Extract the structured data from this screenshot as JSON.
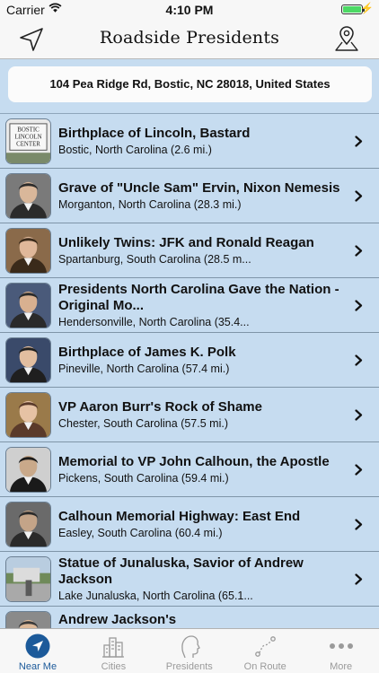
{
  "status_bar": {
    "carrier": "Carrier",
    "time": "4:10 PM",
    "battery_level": 1.0
  },
  "nav": {
    "title": "Roadside Presidents",
    "left_icon": "location-arrow-icon",
    "right_icon": "map-pin-icon"
  },
  "address": "104 Pea Ridge Rd, Bostic, NC  28018, United States",
  "places": [
    {
      "title": "Birthplace of Lincoln, Bastard",
      "subtitle": "Bostic, North Carolina (2.6 mi.)",
      "thumb": "center-sign"
    },
    {
      "title": "Grave of \"Uncle Sam\" Ervin, Nixon Nemesis",
      "subtitle": "Morganton, North Carolina (28.3 mi.)",
      "thumb": "portrait"
    },
    {
      "title": "Unlikely Twins: JFK and Ronald Reagan",
      "subtitle": "Spartanburg, South Carolina (28.5 m...",
      "thumb": "portrait"
    },
    {
      "title": "Presidents North Carolina Gave the Nation - Original Mo...",
      "subtitle": "Hendersonville, North Carolina (35.4...",
      "thumb": "portrait"
    },
    {
      "title": "Birthplace of James K. Polk",
      "subtitle": "Pineville, North Carolina (57.4 mi.)",
      "thumb": "portrait"
    },
    {
      "title": "VP Aaron Burr's Rock of Shame",
      "subtitle": "Chester, South Carolina (57.5 mi.)",
      "thumb": "portrait"
    },
    {
      "title": "Memorial to VP John Calhoun, the Apostle",
      "subtitle": "Pickens, South Carolina (59.4 mi.)",
      "thumb": "portrait"
    },
    {
      "title": "Calhoun Memorial Highway: East End",
      "subtitle": "Easley, South Carolina (60.4 mi.)",
      "thumb": "portrait"
    },
    {
      "title": "Statue of Junaluska, Savior of Andrew Jackson",
      "subtitle": "Lake Junaluska, North Carolina (65.1...",
      "thumb": "photo"
    },
    {
      "title": "Andrew Jackson's",
      "subtitle": "",
      "thumb": "portrait"
    }
  ],
  "thumb_sign_text": [
    "BOSTIC",
    "LINCOLN",
    "CENTER"
  ],
  "tabs": [
    {
      "label": "Near Me",
      "icon": "near-me-icon",
      "active": true
    },
    {
      "label": "Cities",
      "icon": "cities-icon",
      "active": false
    },
    {
      "label": "Presidents",
      "icon": "presidents-icon",
      "active": false
    },
    {
      "label": "On Route",
      "icon": "on-route-icon",
      "active": false
    },
    {
      "label": "More",
      "icon": "more-icon",
      "active": false
    }
  ],
  "colors": {
    "background": "#c6dcf0",
    "accent": "#1c5a9a",
    "tab_inactive": "#9a9a9a",
    "battery": "#4cd964"
  }
}
